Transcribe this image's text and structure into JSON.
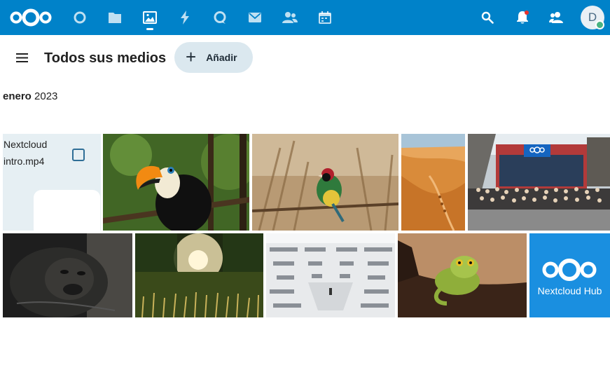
{
  "header": {
    "nav_icons": [
      "dashboard-icon",
      "files-icon",
      "photos-icon",
      "activity-icon",
      "talk-icon",
      "mail-icon",
      "contacts-icon",
      "calendar-icon"
    ],
    "right_icons": [
      "search-icon",
      "notifications-icon",
      "contacts-menu-icon"
    ],
    "avatar_letter": "D",
    "brand_color": "#0082c9",
    "status_color": "#49b382"
  },
  "toolbar": {
    "title": "Todos sus medios",
    "add_label": "Añadir",
    "add_icon": "plus-icon"
  },
  "section": {
    "month_bold": "enero",
    "year": " 2023"
  },
  "tiles": {
    "video": {
      "name": "Nextcloud intro.mp4",
      "icon": "video-icon"
    },
    "hub": {
      "label": "Nextcloud Hub"
    }
  },
  "photos": [
    "toucan",
    "gouldian-finch",
    "desert-dunes",
    "nextcloud-team",
    "gorilla",
    "sunset-field",
    "library",
    "frog",
    "nextcloud-hub"
  ]
}
